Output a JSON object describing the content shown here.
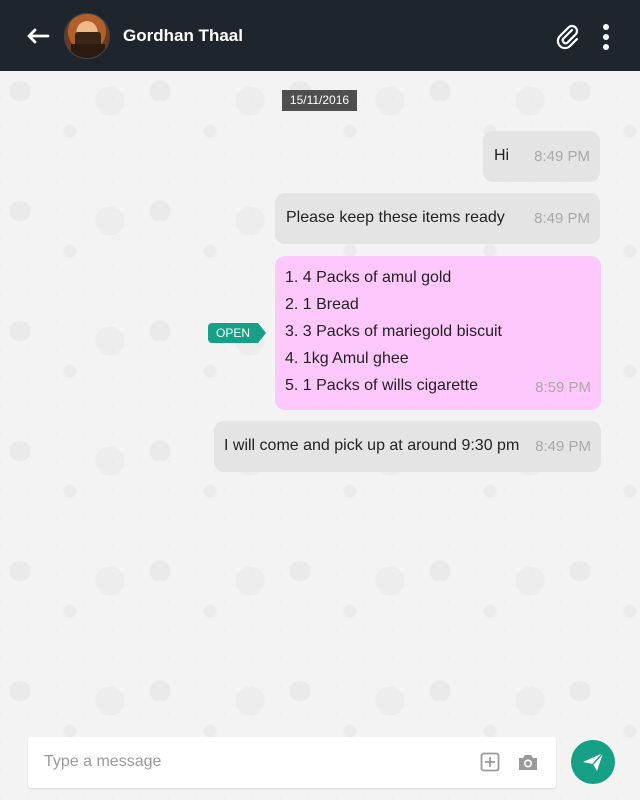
{
  "header": {
    "contact_name": "Gordhan Thaal"
  },
  "date_separator": "15/11/2016",
  "messages": [
    {
      "text": "Hi",
      "time": "8:49 PM"
    },
    {
      "text": "Please keep these items ready",
      "time": "8:49 PM"
    },
    {
      "items": [
        "1. 4 Packs of amul gold",
        "2. 1 Bread",
        "3. 3 Packs of mariegold biscuit",
        "4. 1kg Amul ghee",
        "5. 1 Packs of wills cigarette"
      ],
      "time": "8:59 PM",
      "badge": "OPEN"
    },
    {
      "text": "I will come and pick up at around 9:30 pm",
      "time": "8:49 PM"
    }
  ],
  "composer": {
    "placeholder": "Type a message"
  },
  "colors": {
    "header_bg": "#1e252c",
    "accent": "#16a085",
    "bubble_gray": "#e4e4e4",
    "bubble_pink": "#fec8fc"
  },
  "icons": [
    "back-arrow-icon",
    "paperclip-icon",
    "more-vertical-icon",
    "add-icon",
    "camera-icon",
    "send-icon"
  ]
}
